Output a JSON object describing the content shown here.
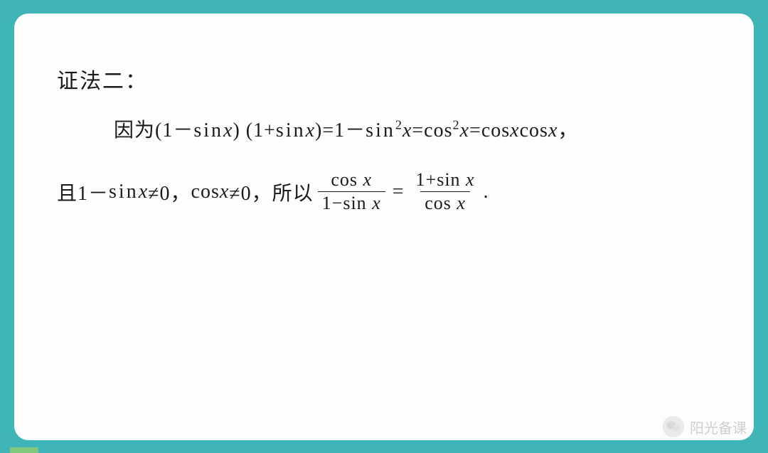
{
  "heading": "证法二：",
  "line1": {
    "prefix": "因为",
    "expr_open": "(1－",
    "sin_text": "sin",
    "x": "x",
    "expr_mid1": ") (1+",
    "expr_mid2": ")=1－",
    "sq": "2",
    "eq1": "=cos",
    "eq2": "=cos",
    "cos_text": "cos",
    "comma": "，"
  },
  "line2": {
    "prefix": "且1－",
    "sin_text": "sin",
    "x": "x",
    "neq1": "≠0，",
    "cos_text": "cos",
    "neq2": "≠0，",
    "so": "所以 ",
    "frac1_num_a": "cos ",
    "frac1_den_a": "1",
    "frac1_den_b": "sin ",
    "minus": "−",
    "eq": "=",
    "frac2_num_a": "1",
    "frac2_num_b": "sin ",
    "plus": "+",
    "frac2_den_a": "cos ",
    "period": " ."
  },
  "watermark": {
    "text": "阳光备课"
  },
  "chart_data": {
    "type": "table",
    "title": "证法二",
    "content": "因为 (1−sinx)(1+sinx) = 1−sin²x = cos²x = cosx·cosx，且 1−sinx≠0，cosx≠0，所以 cosx/(1−sinx) = (1+sinx)/cosx ."
  }
}
